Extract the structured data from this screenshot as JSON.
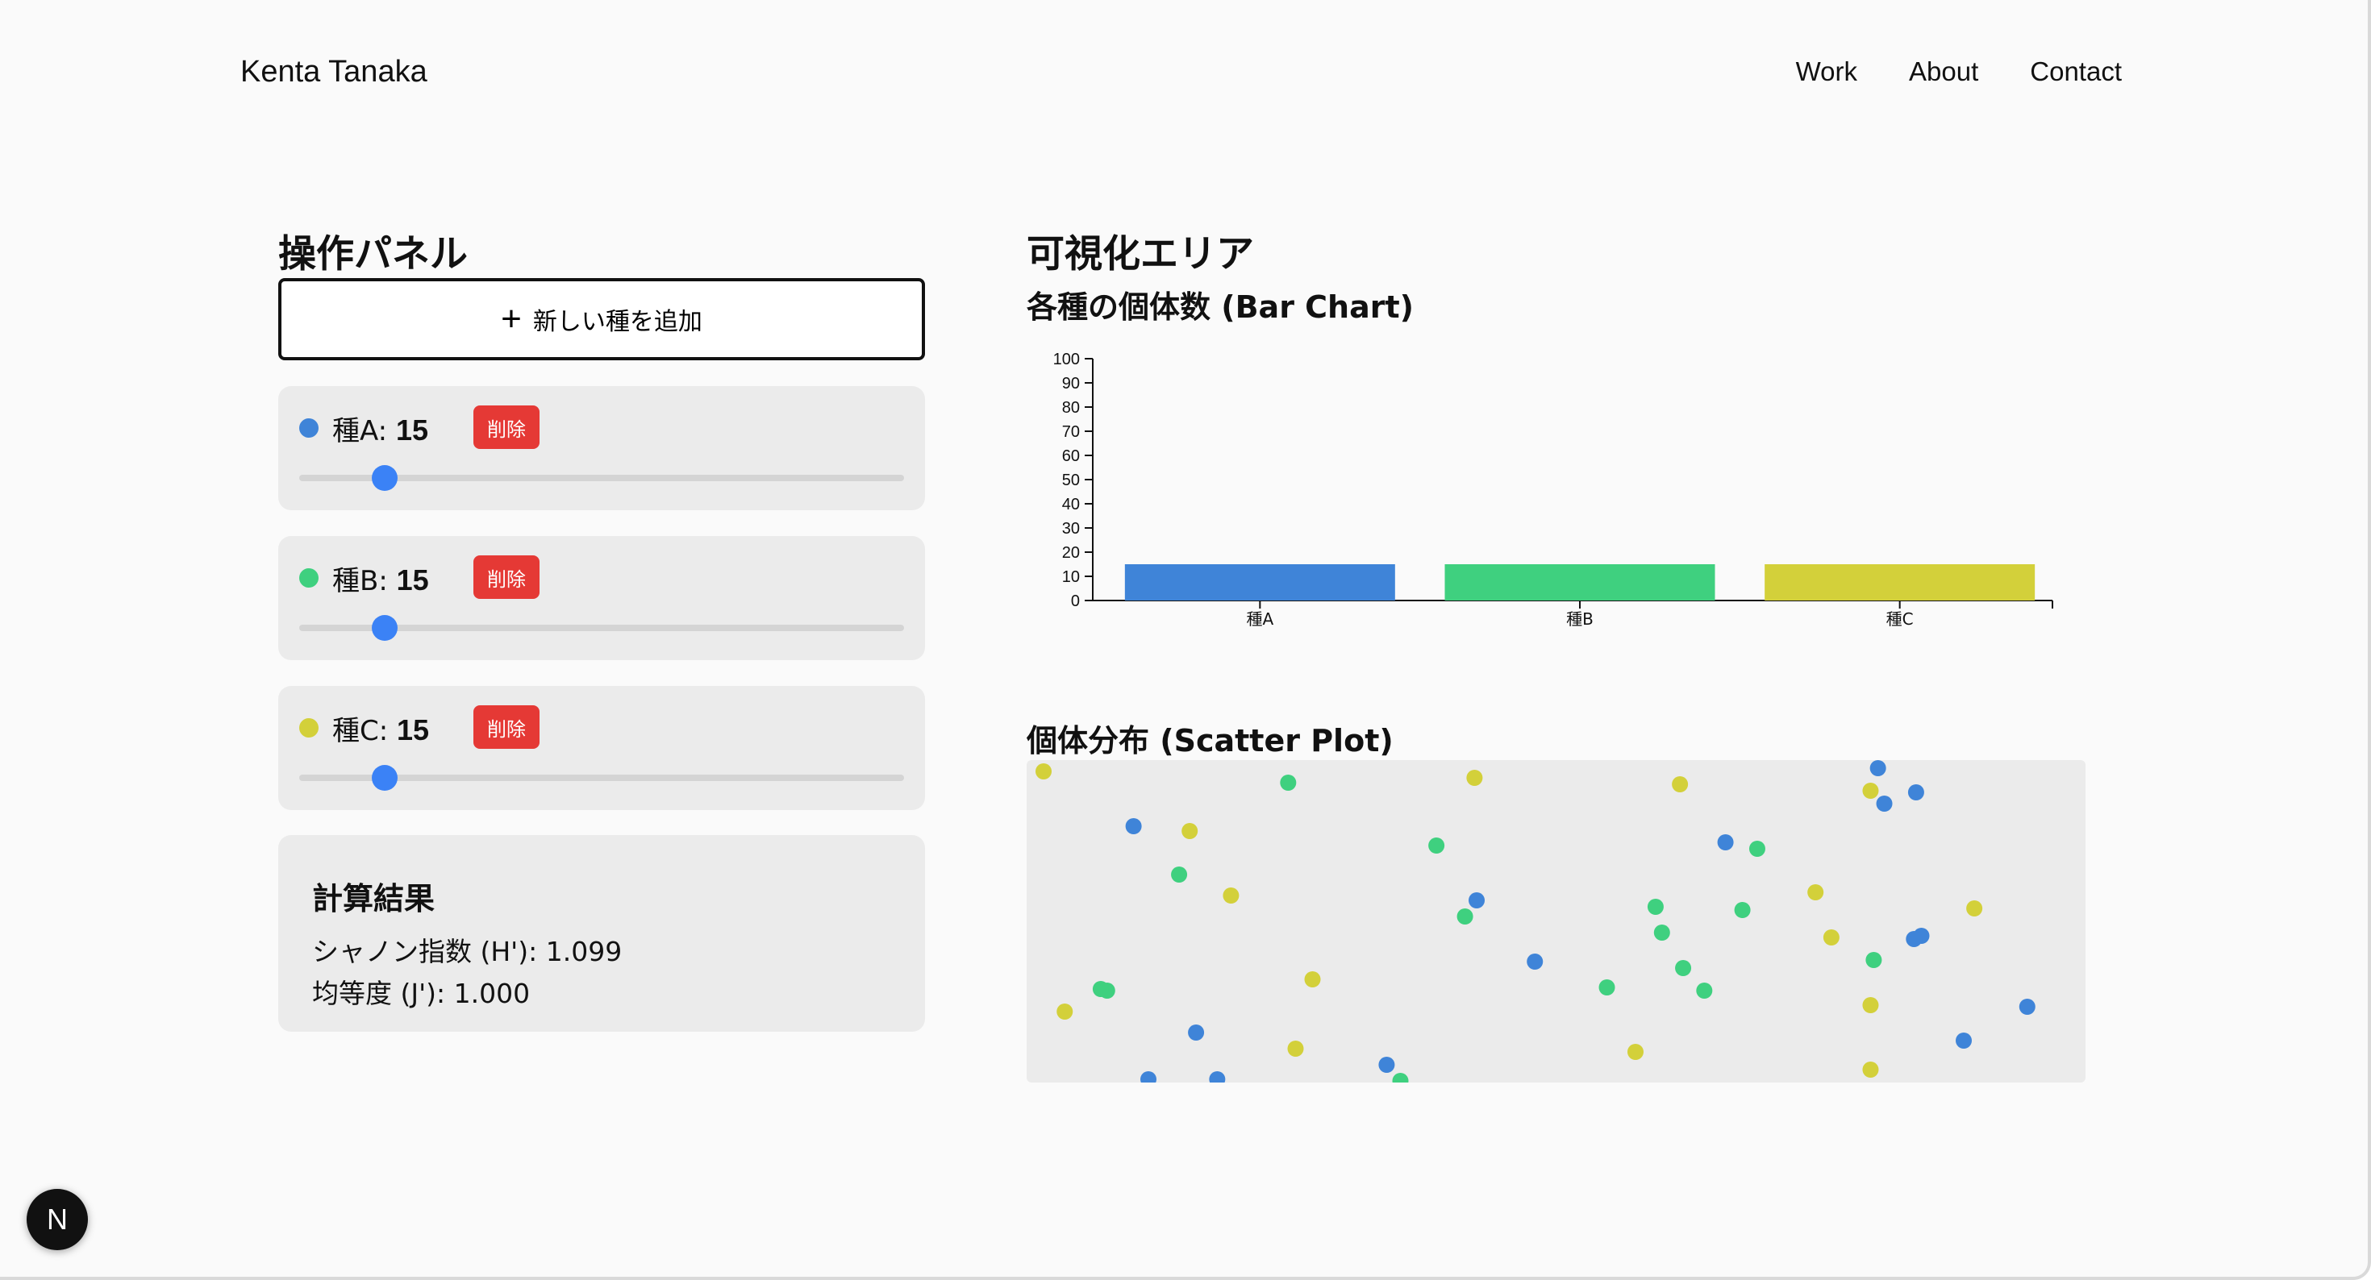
{
  "nav": {
    "logo": "Kenta Tanaka",
    "links": [
      "Work",
      "About",
      "Contact"
    ]
  },
  "panel": {
    "title": "操作パネル",
    "add_button": "新しい種を追加",
    "delete_label": "削除",
    "max_value": 100,
    "species": [
      {
        "label": "種A: ",
        "count": "15",
        "value": 15,
        "color": "#3f84d8"
      },
      {
        "label": "種B: ",
        "count": "15",
        "value": 15,
        "color": "#3fd07f"
      },
      {
        "label": "種C: ",
        "count": "15",
        "value": 15,
        "color": "#d3d03a"
      }
    ]
  },
  "results": {
    "title": "計算結果",
    "shannon": "シャノン指数 (H'): 1.099",
    "evenness": "均等度 (J'): 1.000"
  },
  "viz": {
    "title": "可視化エリア",
    "bar_title": "各種の個体数 (Bar Chart)",
    "scatter_title": "個体分布 (Scatter Plot)"
  },
  "badge": {
    "letter": "N"
  },
  "chart_data": [
    {
      "type": "bar",
      "categories": [
        "種A",
        "種B",
        "種C"
      ],
      "values": [
        15,
        15,
        15
      ],
      "colors": [
        "#3f84d8",
        "#3fd07f",
        "#d3d03a"
      ],
      "ylim": [
        0,
        100
      ],
      "yticks": [
        0,
        10,
        20,
        30,
        40,
        50,
        60,
        70,
        80,
        90,
        100
      ],
      "title": "各種の個体数 (Bar Chart)",
      "xlabel": "",
      "ylabel": "",
      "grid": false
    },
    {
      "type": "scatter",
      "title": "個体分布 (Scatter Plot)",
      "xlim": [
        0,
        1
      ],
      "ylim": [
        0,
        1
      ],
      "series": [
        {
          "color": "#3f84d8",
          "points": [
            [
              0.115,
              0.01
            ],
            [
              0.18,
              0.01
            ],
            [
              0.101,
              0.795
            ],
            [
              0.84,
              0.9
            ],
            [
              0.81,
              0.865
            ],
            [
              0.66,
              0.745
            ],
            [
              0.425,
              0.565
            ],
            [
              0.48,
              0.375
            ],
            [
              0.16,
              0.155
            ],
            [
              0.34,
              0.055
            ],
            [
              0.845,
              0.455
            ],
            [
              0.838,
              0.445
            ],
            [
              0.945,
              0.235
            ],
            [
              0.885,
              0.13
            ],
            [
              0.804,
              0.975
            ]
          ]
        },
        {
          "color": "#3fd07f",
          "points": [
            [
              0.247,
              0.93
            ],
            [
              0.387,
              0.735
            ],
            [
              0.144,
              0.645
            ],
            [
              0.414,
              0.515
            ],
            [
              0.594,
              0.545
            ],
            [
              0.676,
              0.535
            ],
            [
              0.6,
              0.465
            ],
            [
              0.69,
              0.725
            ],
            [
              0.62,
              0.355
            ],
            [
              0.548,
              0.295
            ],
            [
              0.64,
              0.285
            ],
            [
              0.8,
              0.38
            ],
            [
              0.076,
              0.285
            ],
            [
              0.353,
              0.005
            ],
            [
              0.07,
              0.29
            ]
          ]
        },
        {
          "color": "#d3d03a",
          "points": [
            [
              0.016,
              0.965
            ],
            [
              0.423,
              0.945
            ],
            [
              0.617,
              0.925
            ],
            [
              0.797,
              0.905
            ],
            [
              0.154,
              0.78
            ],
            [
              0.193,
              0.58
            ],
            [
              0.745,
              0.59
            ],
            [
              0.895,
              0.54
            ],
            [
              0.76,
              0.45
            ],
            [
              0.27,
              0.32
            ],
            [
              0.036,
              0.22
            ],
            [
              0.797,
              0.24
            ],
            [
              0.254,
              0.105
            ],
            [
              0.575,
              0.095
            ],
            [
              0.797,
              0.04
            ]
          ]
        }
      ]
    }
  ]
}
